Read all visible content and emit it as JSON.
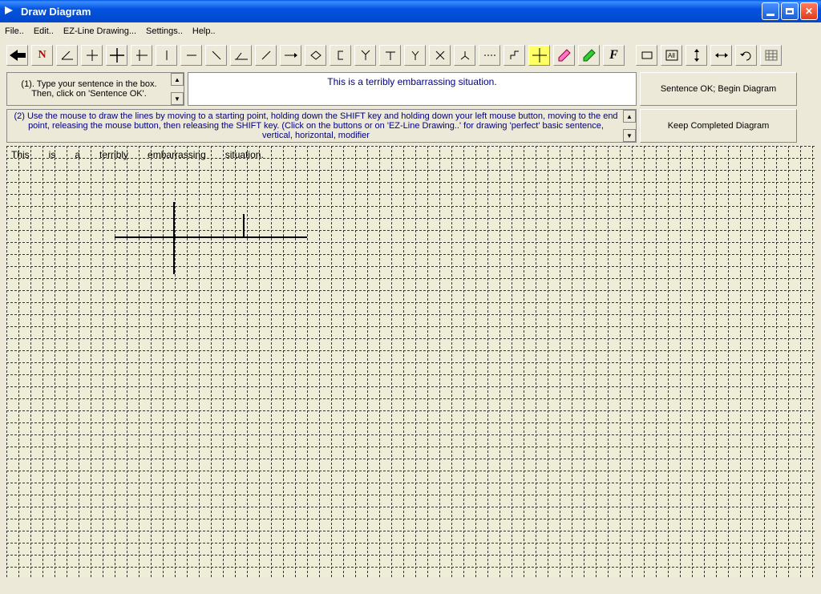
{
  "window": {
    "title": "Draw Diagram"
  },
  "menu": {
    "file": "File..",
    "edit": "Edit..",
    "ezline": "EZ-Line Drawing...",
    "settings": "Settings..",
    "help": "Help.."
  },
  "toolbar": {
    "back": "back-arrow",
    "n": "N",
    "f": "F"
  },
  "instructions": {
    "step1": "(1). Type your sentence in the box. Then, click on 'Sentence OK'.",
    "step2": "(2) Use the mouse to draw the lines by moving to a starting point, holding down the SHIFT key and holding down your left mouse button, moving to the end point, releasing the mouse button, then releasing the SHIFT key. (Click on the buttons or on 'EZ-Line Drawing..' for drawing 'perfect' basic sentence, vertical, horizontal, modifier"
  },
  "sentence": {
    "text": "This is a terribly embarrassing situation."
  },
  "buttons": {
    "begin": "Sentence OK; Begin Diagram",
    "keep": "Keep Completed Diagram"
  },
  "words": [
    "This",
    "is",
    "a",
    "terribly",
    "embarrassing",
    "situation."
  ]
}
